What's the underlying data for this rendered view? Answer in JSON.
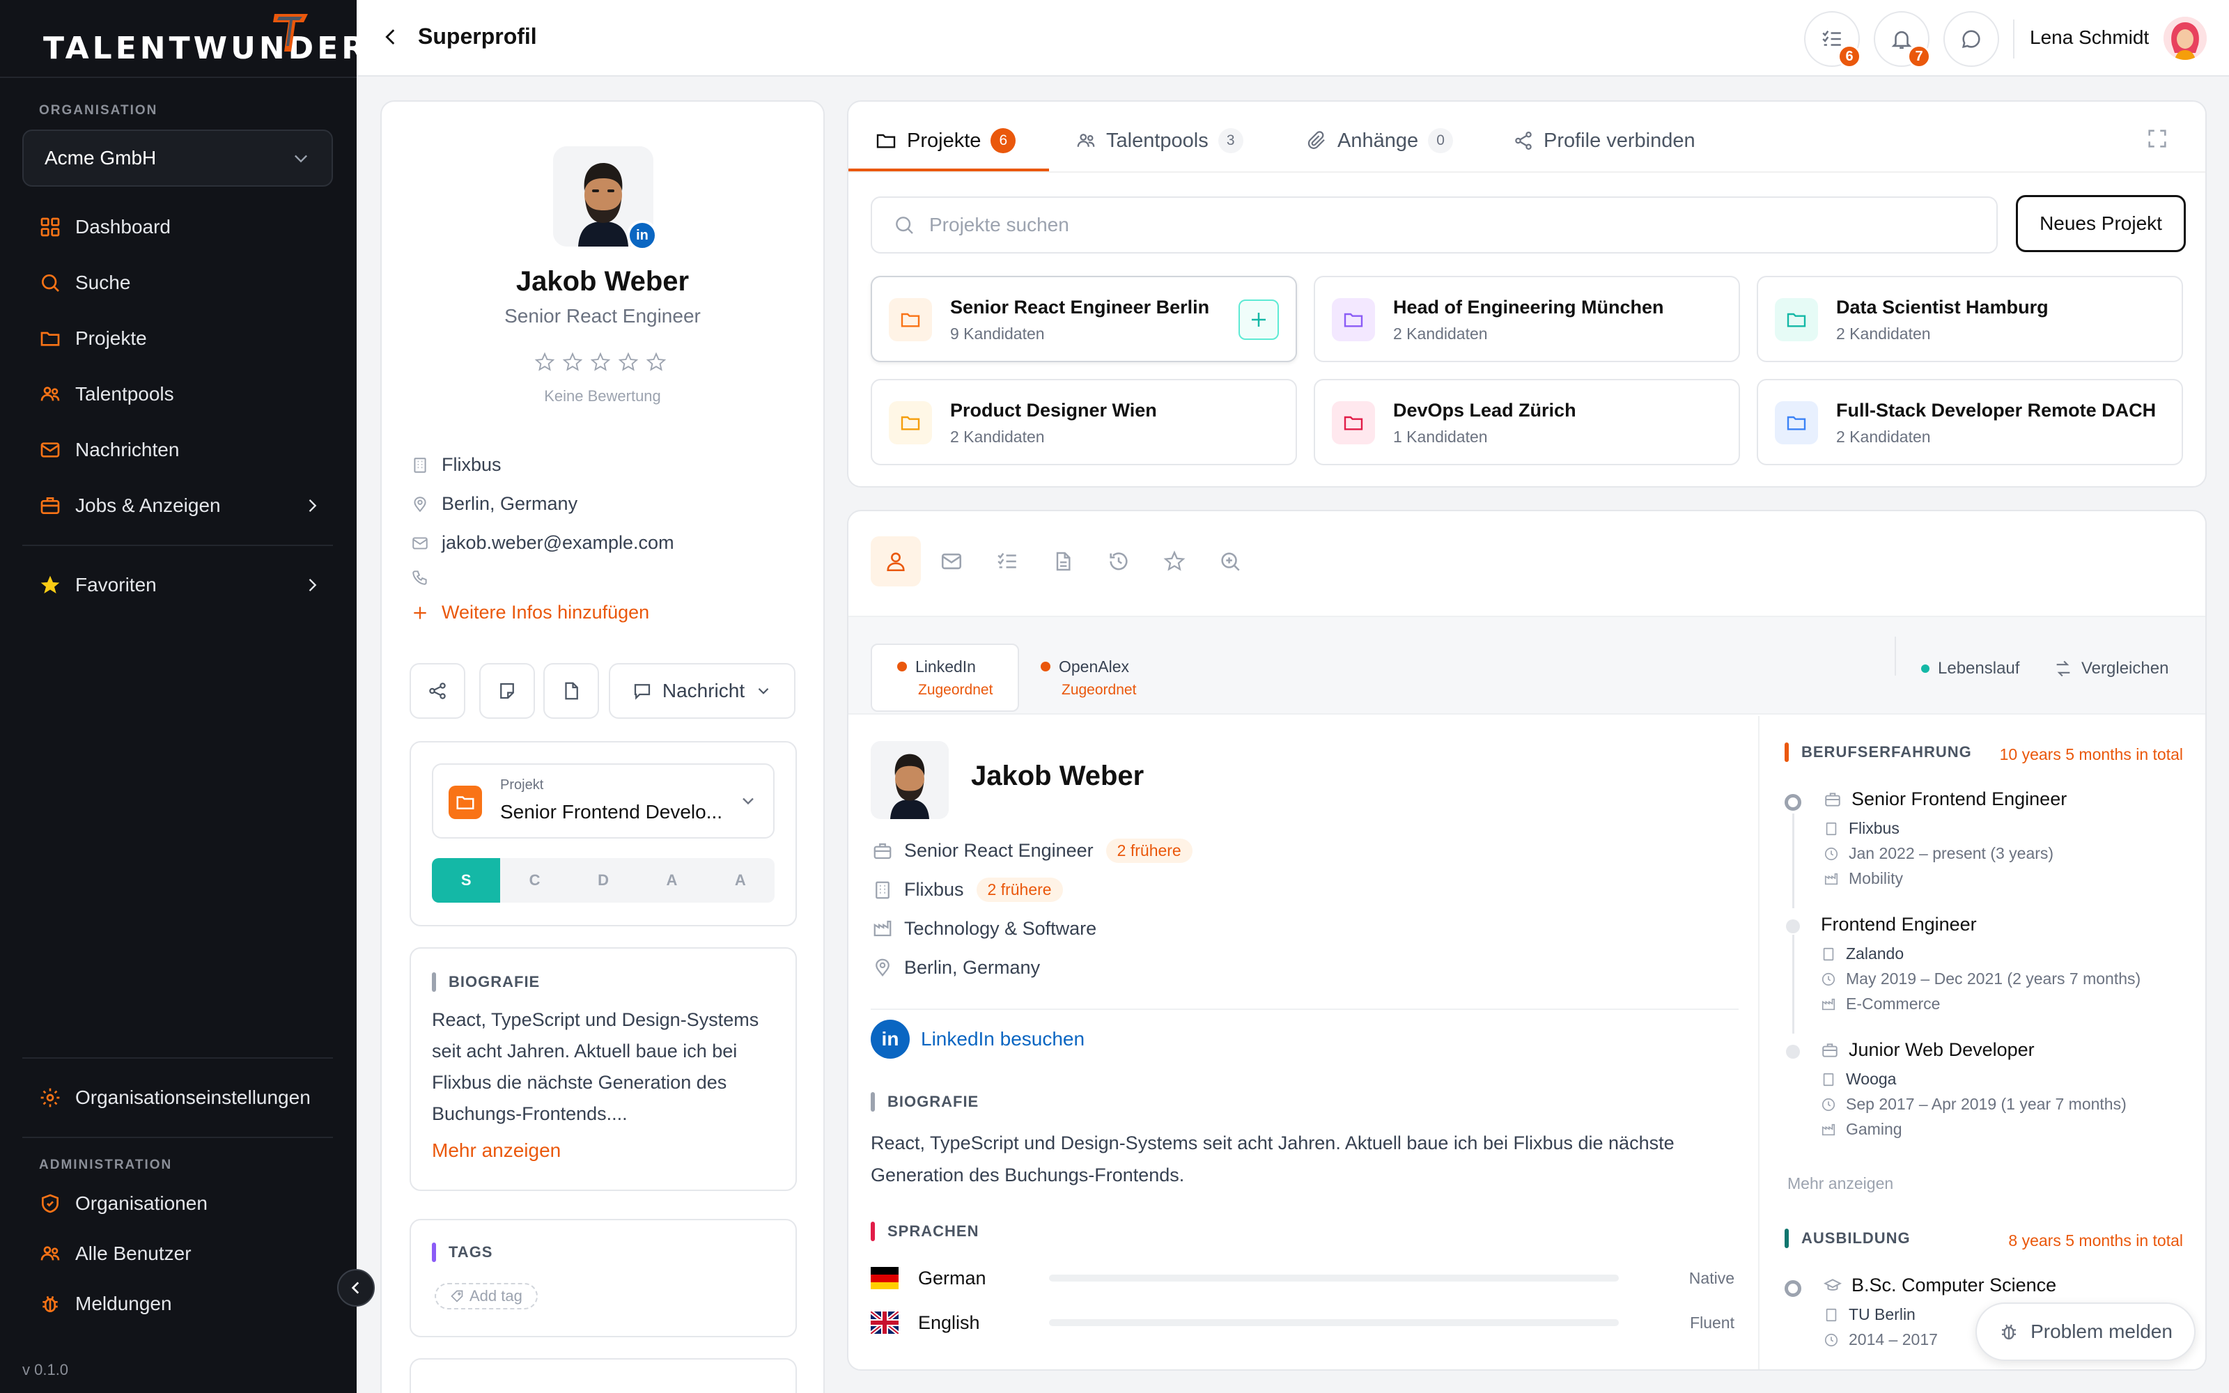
{
  "app": {
    "logo_text": "TALENTWUNDER",
    "version": "v 0.1.0"
  },
  "sidebar": {
    "org_section": "ORGANISATION",
    "org_value": "Acme GmbH",
    "items": [
      {
        "label": "Dashboard",
        "icon": "dashboard-icon"
      },
      {
        "label": "Suche",
        "icon": "search-icon"
      },
      {
        "label": "Projekte",
        "icon": "folder-icon"
      },
      {
        "label": "Talentpools",
        "icon": "users-icon"
      },
      {
        "label": "Nachrichten",
        "icon": "mail-icon"
      },
      {
        "label": "Jobs & Anzeigen",
        "icon": "briefcase-icon"
      }
    ],
    "favorites": "Favoriten",
    "settings": "Organisationseinstellungen",
    "admin_section": "ADMINISTRATION",
    "admin_items": [
      {
        "label": "Organisationen",
        "icon": "shield-icon"
      },
      {
        "label": "Alle Benutzer",
        "icon": "users-icon"
      },
      {
        "label": "Meldungen",
        "icon": "bug-icon"
      }
    ]
  },
  "topbar": {
    "title": "Superprofil",
    "tasks_count": "6",
    "notifications_count": "7",
    "user_name": "Lena Schmidt"
  },
  "profile": {
    "name": "Jakob Weber",
    "role": "Senior React Engineer",
    "rating_text": "Keine Bewertung",
    "rating": 0,
    "company": "Flixbus",
    "location": "Berlin, Germany",
    "email": "jakob.weber@example.com",
    "add_info": "Weitere Infos hinzufügen",
    "message_button": "Nachricht",
    "project_label": "Projekt",
    "project_value": "Senior Frontend Develo...",
    "stages": [
      "S",
      "C",
      "D",
      "A",
      "A"
    ],
    "bio_heading": "BIOGRAFIE",
    "bio_text": "React, TypeScript und Design-Systems seit acht Jahren. Aktuell baue ich bei Flixbus die nächste Generation des Buchungs-Frontends....",
    "more": "Mehr anzeigen",
    "tags_heading": "TAGS",
    "add_tag": "Add tag"
  },
  "projects": {
    "tabs": [
      {
        "label": "Projekte",
        "count": "6"
      },
      {
        "label": "Talentpools",
        "count": "3"
      },
      {
        "label": "Anhänge",
        "count": "0"
      },
      {
        "label": "Profile verbinden",
        "count": ""
      }
    ],
    "search_placeholder": "Projekte suchen",
    "new_button": "Neues Projekt",
    "items": [
      {
        "name": "Senior React Engineer Berlin",
        "sub": "9 Kandidaten",
        "color": "#f97316",
        "bg": "#fff3e6"
      },
      {
        "name": "Head of Engineering München",
        "sub": "2 Kandidaten",
        "color": "#8b5cf6",
        "bg": "#f3e8ff"
      },
      {
        "name": "Data Scientist Hamburg",
        "sub": "2 Kandidaten",
        "color": "#14b8a6",
        "bg": "#e6fbf6"
      },
      {
        "name": "Product Designer Wien",
        "sub": "2 Kandidaten",
        "color": "#f59e0b",
        "bg": "#fff7e6"
      },
      {
        "name": "DevOps Lead Zürich",
        "sub": "1 Kandidaten",
        "color": "#e11d48",
        "bg": "#ffe8ee"
      },
      {
        "name": "Full-Stack Developer Remote DACH",
        "sub": "2 Kandidaten",
        "color": "#3b82f6",
        "bg": "#e8f0fe"
      }
    ]
  },
  "detail": {
    "sources": [
      {
        "name": "LinkedIn",
        "status": "Zugeordnet"
      },
      {
        "name": "OpenAlex",
        "status": "Zugeordnet"
      }
    ],
    "cv_label": "Lebenslauf",
    "compare_label": "Vergleichen",
    "name": "Jakob Weber",
    "title": "Senior React Engineer",
    "title_prev": "2 frühere",
    "company": "Flixbus",
    "company_prev": "2 frühere",
    "industry": "Technology & Software",
    "location": "Berlin, Germany",
    "linkedin": "LinkedIn besuchen",
    "bio_heading": "BIOGRAFIE",
    "bio_text": "React, TypeScript und Design-Systems seit acht Jahren. Aktuell baue ich bei Flixbus die nächste Generation des Buchungs-Frontends.",
    "lang_heading": "SPRACHEN",
    "languages": [
      {
        "name": "German",
        "level": "Native"
      },
      {
        "name": "English",
        "level": "Fluent"
      }
    ],
    "exp_heading": "BERUFSERFAHRUNG",
    "exp_total": "10 years 5 months in total",
    "experience": [
      {
        "title": "Senior Frontend Engineer",
        "company": "Flixbus",
        "period": "Jan 2022 – present (3 years)",
        "industry": "Mobility"
      },
      {
        "title": "Frontend Engineer",
        "company": "Zalando",
        "period": "May 2019 – Dec 2021 (2 years 7 months)",
        "industry": "E-Commerce"
      },
      {
        "title": "Junior Web Developer",
        "company": "Wooga",
        "period": "Sep 2017 – Apr 2019 (1 year 7 months)",
        "industry": "Gaming"
      }
    ],
    "exp_more": "Mehr anzeigen",
    "edu_heading": "AUSBILDUNG",
    "edu_total": "8 years 5 months in total",
    "education": [
      {
        "title": "B.Sc. Computer Science",
        "school": "TU Berlin",
        "period": "2014 – 2017"
      }
    ]
  },
  "problem_button": "Problem melden",
  "colors": {
    "accent": "#ea580c",
    "teal": "#14b8a6",
    "linkedin": "#0a66c2"
  }
}
